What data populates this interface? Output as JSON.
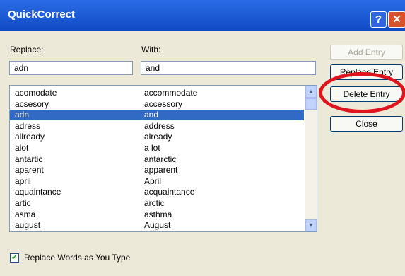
{
  "window": {
    "title": "QuickCorrect",
    "help_glyph": "?",
    "close_glyph": "✕"
  },
  "fields": {
    "replace_label": "Replace:",
    "with_label": "With:",
    "replace_value": "adn",
    "with_value": "and"
  },
  "list": [
    {
      "replace": "acomodate",
      "with": "accommodate"
    },
    {
      "replace": "acsesory",
      "with": "accessory"
    },
    {
      "replace": "adn",
      "with": "and",
      "selected": true
    },
    {
      "replace": "adress",
      "with": "address"
    },
    {
      "replace": "allready",
      "with": "already"
    },
    {
      "replace": "alot",
      "with": "a lot"
    },
    {
      "replace": "antartic",
      "with": "antarctic"
    },
    {
      "replace": "aparent",
      "with": "apparent"
    },
    {
      "replace": "april",
      "with": "April"
    },
    {
      "replace": "aquaintance",
      "with": "acquaintance"
    },
    {
      "replace": "artic",
      "with": "arctic"
    },
    {
      "replace": "asma",
      "with": "asthma"
    },
    {
      "replace": "august",
      "with": "August"
    }
  ],
  "buttons": {
    "add_entry": "Add Entry",
    "replace_entry": "Replace Entry",
    "delete_entry": "Delete Entry",
    "close": "Close"
  },
  "options": {
    "replace_as_you_type_label": "Replace Words as You Type",
    "replace_as_you_type_checked": true
  },
  "colors": {
    "titlebar": "#1f5fd8",
    "selection": "#316ac5",
    "highlight_ellipse": "#e0141c"
  }
}
